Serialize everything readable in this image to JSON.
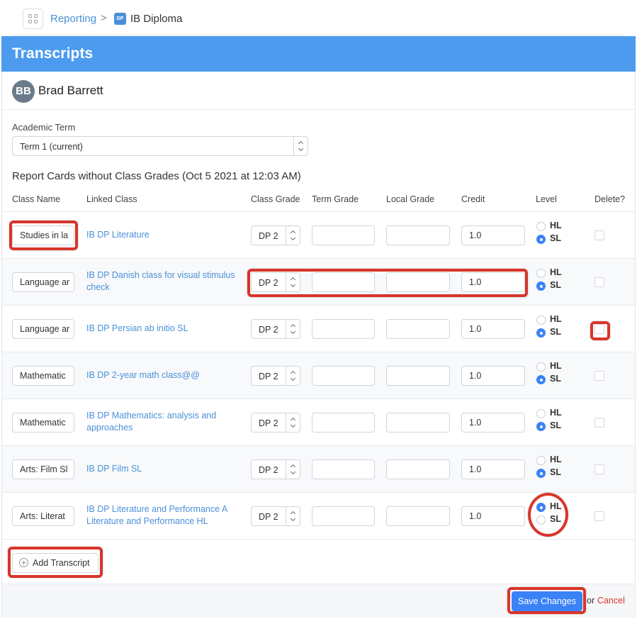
{
  "breadcrumb": {
    "items": [
      "Reporting",
      "IB Diploma"
    ],
    "dp_icon_text": "DP",
    "separator": ">"
  },
  "header": {
    "title": "Transcripts"
  },
  "student": {
    "initials": "BB",
    "name": "Brad Barrett"
  },
  "academic_term": {
    "label": "Academic Term",
    "selected": "Term 1 (current)"
  },
  "section_title": "Report Cards without Class Grades (Oct 5 2021 at 12:03 AM)",
  "columns": [
    "Class Name",
    "Linked Class",
    "Class Grade",
    "Term Grade",
    "Local Grade",
    "Credit",
    "Level",
    "Delete?"
  ],
  "rows": [
    {
      "class_name": "Studies in la",
      "linked_line1": "IB DP Literature",
      "linked_line2": "",
      "grade": "DP 2",
      "credit": "1.0",
      "level": "SL"
    },
    {
      "class_name": "Language ar",
      "linked_line1": "IB DP Danish class for visual stimulus",
      "linked_line2": "check",
      "grade": "DP 2",
      "credit": "1.0",
      "level": "SL"
    },
    {
      "class_name": "Language ar",
      "linked_line1": "IB DP Persian ab initio SL",
      "linked_line2": "",
      "grade": "DP 2",
      "credit": "1.0",
      "level": "SL"
    },
    {
      "class_name": "Mathematic",
      "linked_line1": "IB DP 2-year math class@@",
      "linked_line2": "",
      "grade": "DP 2",
      "credit": "1.0",
      "level": "SL"
    },
    {
      "class_name": "Mathematic",
      "linked_line1": "IB DP Mathematics: analysis and",
      "linked_line2": "approaches",
      "grade": "DP 2",
      "credit": "1.0",
      "level": "SL"
    },
    {
      "class_name": "Arts: Film Sl",
      "linked_line1": "IB DP Film SL",
      "linked_line2": "",
      "grade": "DP 2",
      "credit": "1.0",
      "level": "SL"
    },
    {
      "class_name": "Arts: Literat",
      "linked_line1": "IB DP Literature and Performance A",
      "linked_line2": "Literature and Performance HL",
      "grade": "DP 2",
      "credit": "1.0",
      "level": "HL"
    }
  ],
  "level_options": [
    "HL",
    "SL"
  ],
  "add_transcript_label": "Add Transcript",
  "footer": {
    "save_label": "Save Changes",
    "or_text": "or",
    "cancel_label": "Cancel"
  },
  "colors": {
    "header": "#4d9bef",
    "link": "#4a90d9",
    "highlight": "#d9342b",
    "primary": "#3b82f6"
  }
}
